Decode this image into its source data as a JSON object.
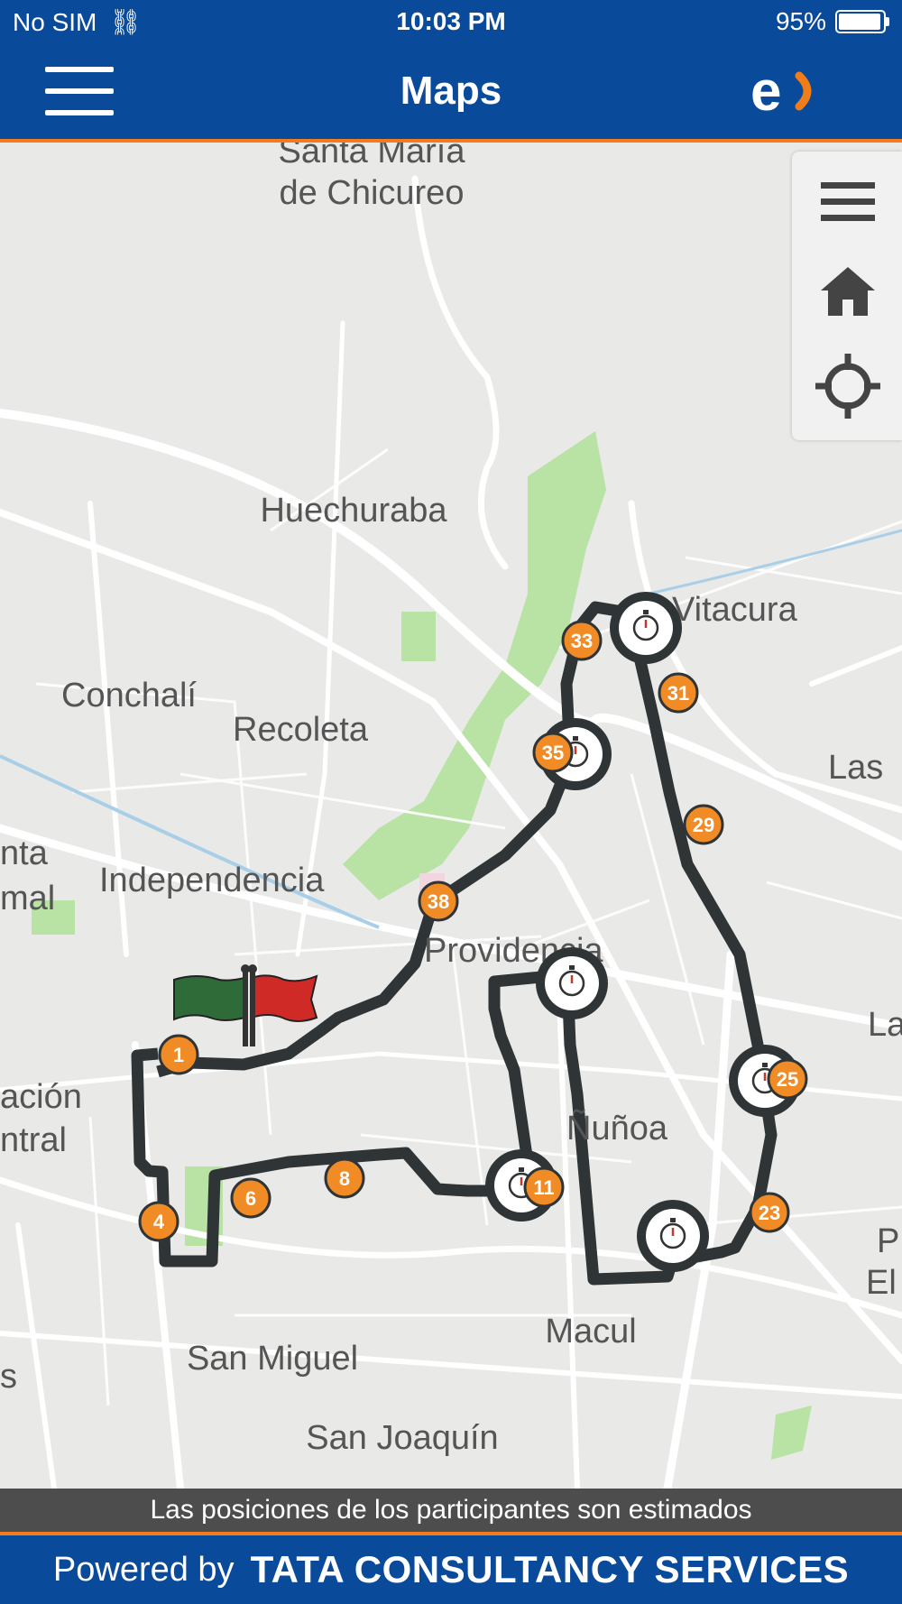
{
  "status": {
    "carrier": "No SIM",
    "time": "10:03 PM",
    "battery": "95%",
    "battery_level": 0.95
  },
  "header": {
    "title": "Maps",
    "brand_logo": "e"
  },
  "map": {
    "labels": {
      "santa_maria_1": "Santa María",
      "santa_maria_2": "de Chicureo",
      "huechuraba": "Huechuraba",
      "vitacura": "Vitacura",
      "conchali": "Conchalí",
      "recoleta": "Recoleta",
      "las_right": "Las",
      "nta": "nta",
      "mal": "mal",
      "independencia": "Independencia",
      "providencia": "Providencia",
      "la_right": "La",
      "acion": "ación",
      "ntral": "ntral",
      "nunoa": "Ñuñoa",
      "p_right": "P",
      "el_right": "El",
      "macul": "Macul",
      "san_miguel": "San Miguel",
      "san_joaquin": "San Joaquín",
      "s_left": "s"
    },
    "markers": [
      "1",
      "4",
      "6",
      "8",
      "11",
      "23",
      "25",
      "29",
      "31",
      "33",
      "35",
      "38"
    ],
    "timing_points": 6,
    "route_color": "#2f3536",
    "marker_color": "#f08b25"
  },
  "controls": {
    "layers_icon": "hamburger-icon",
    "home_icon": "home-icon",
    "locate_icon": "crosshair-icon"
  },
  "banner": {
    "text": "Las posiciones de los participantes son estimados"
  },
  "footer": {
    "powered_by": "Powered by",
    "company": "TATA CONSULTANCY SERVICES"
  }
}
